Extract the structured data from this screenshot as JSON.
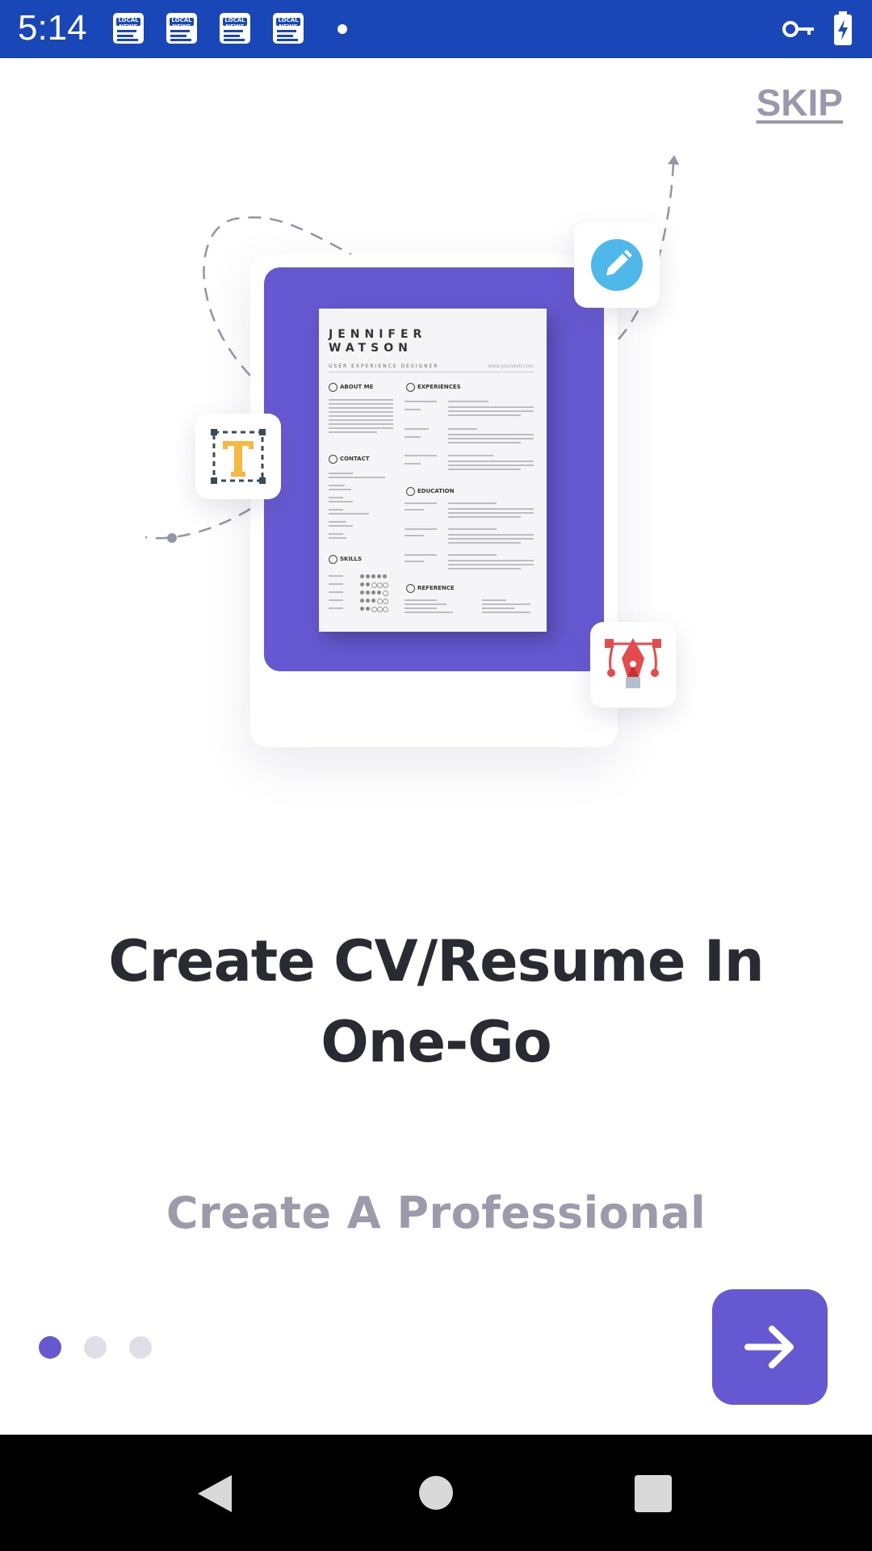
{
  "status_bar": {
    "time": "5:14",
    "notifications": [
      {
        "icon": "local-news-icon",
        "text": "LOCAL NEWS"
      },
      {
        "icon": "local-news-icon",
        "text": "LOCAL NEWS"
      },
      {
        "icon": "local-news-icon",
        "text": "LOCAL NEWS"
      },
      {
        "icon": "local-news-icon",
        "text": "LOCAL NEWS"
      }
    ],
    "icons": [
      "vpn-key-icon",
      "battery-charging-icon"
    ],
    "color": "#1a47b8"
  },
  "skip_label": "SKIP",
  "illustration": {
    "resume": {
      "first_name": "JENNIFER",
      "last_name": "WATSON",
      "role": "USER EXPERIENCE DESIGNER",
      "website": "www.yourweb.com",
      "sections_left": [
        "ABOUT ME",
        "CONTACT",
        "SKILLS"
      ],
      "sections_right": [
        "EXPERIENCES",
        "EDUCATION",
        "REFERENCE"
      ],
      "skills": [
        "SKILL 01",
        "SKILL 02",
        "SKILL 03",
        "SKILL 04",
        "SKILL 05"
      ]
    },
    "icons": [
      "edit-pencil-icon",
      "text-tool-icon",
      "pen-tool-icon"
    ],
    "accent": "#6658d0"
  },
  "title": "Create CV/Resume In One-Go",
  "subtitle": "Create A Professional",
  "pager": {
    "count": 3,
    "active": 1
  },
  "next_icon": "arrow-right-icon",
  "nav": [
    "back-icon",
    "home-icon",
    "recents-icon"
  ],
  "colors": {
    "primary": "#6658d0",
    "title": "#2a2a33",
    "subtitle": "#9c9aab"
  }
}
